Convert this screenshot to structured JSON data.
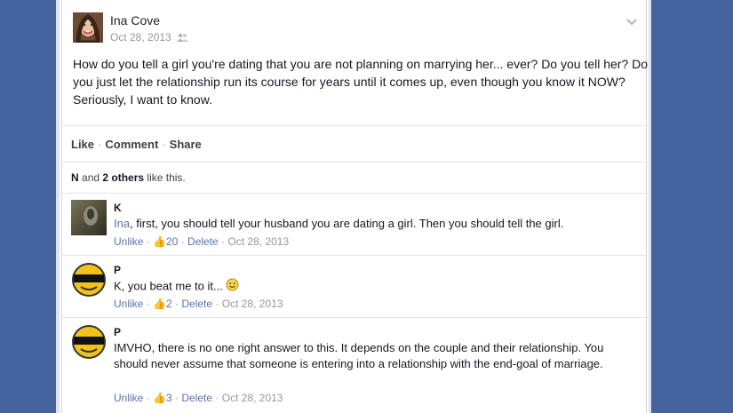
{
  "post": {
    "author": "Ina Cove",
    "date": "Oct 28, 2013",
    "text": "How do you tell a girl you're dating that you are not planning on marrying her... ever? Do you tell her? Do you just let the relationship run its course for years until it comes up, even though you know it NOW? Seriously, I want to know."
  },
  "actions": {
    "like": "Like",
    "comment": "Comment",
    "share": "Share",
    "sep": "·"
  },
  "likes": {
    "first": "N",
    "and": "and",
    "others": "2 others",
    "suffix": "like this."
  },
  "comments": [
    {
      "name": "K",
      "mention": "Ina",
      "text": ", first, you should tell your husband you are dating a girl. Then you should tell the girl.",
      "unlike": "Unlike",
      "likes": "20",
      "delete": "Delete",
      "date": "Oct 28, 2013"
    },
    {
      "name": "P",
      "text": "K, you beat me to it...",
      "unlike": "Unlike",
      "likes": "2",
      "delete": "Delete",
      "date": "Oct 28, 2013"
    },
    {
      "name": "P",
      "text": "IMVHO, there is no one right answer to this. It depends on the couple and their relationship. You should never assume that someone is entering into a relationship with the end-goal of marriage.",
      "unlike": "Unlike",
      "likes": "3",
      "delete": "Delete",
      "date": "Oct 28, 2013"
    }
  ],
  "colors": {
    "background": "#44639e",
    "link": "#5b72a9",
    "meta": "#9197a3"
  }
}
